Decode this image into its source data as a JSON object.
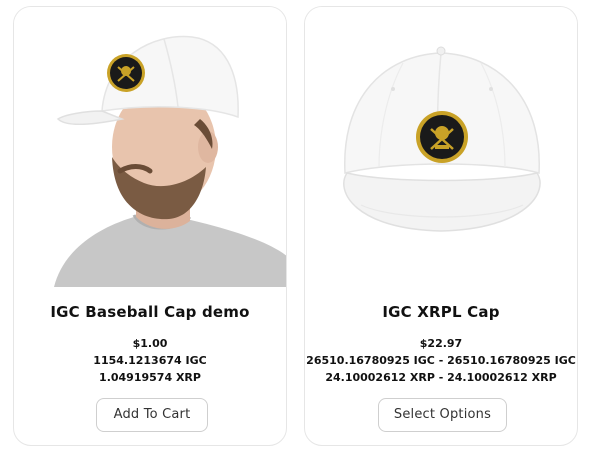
{
  "products": [
    {
      "title": "IGC Baseball Cap demo",
      "price_usd": "$1.00",
      "price_igc": "1154.1213674 IGC",
      "price_xrp": "1.04919574 XRP",
      "button_label": "Add To Cart",
      "image_icon": "man-wearing-cap-photo"
    },
    {
      "title": "IGC XRPL Cap",
      "price_usd": "$22.97",
      "price_igc": "26510.16780925 IGC - 26510.16780925 IGC",
      "price_xrp": "24.10002612 XRP - 24.10002612 XRP",
      "button_label": "Select Options",
      "image_icon": "white-cap-photo"
    }
  ],
  "colors": {
    "badge_gold": "#c9a227",
    "badge_dark": "#1a1a1a",
    "cap_white": "#f7f7f7",
    "shirt_gray": "#bdbdbd",
    "skin": "#e8c4ad"
  }
}
